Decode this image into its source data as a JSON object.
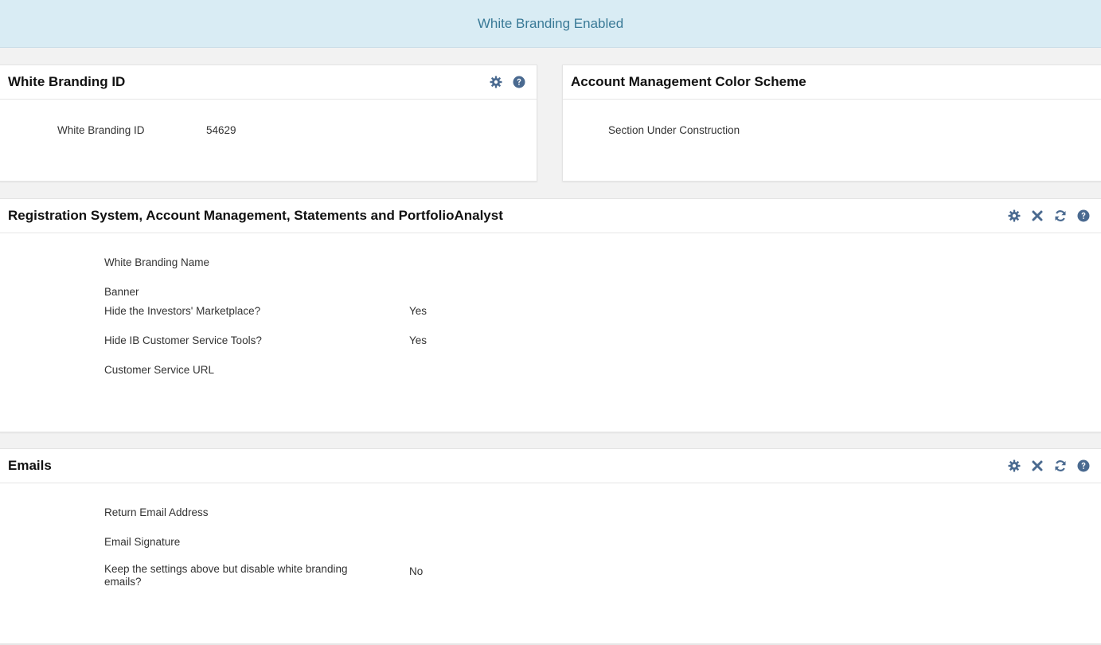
{
  "banner": {
    "text": "White Branding Enabled"
  },
  "colors": {
    "banner_bg": "#d9ecf4",
    "banner_text": "#3a7a97",
    "icon": "#4a6a90"
  },
  "panel_id": {
    "title": "White Branding ID",
    "icons": [
      "gear-icon",
      "help-icon"
    ],
    "fields": [
      {
        "label": "White Branding ID",
        "value": "54629"
      }
    ]
  },
  "panel_color": {
    "title": "Account Management Color Scheme",
    "message": "Section Under Construction"
  },
  "panel_registration": {
    "title": "Registration System, Account Management, Statements and PortfolioAnalyst",
    "icons": [
      "gear-icon",
      "close-icon",
      "refresh-icon",
      "help-icon"
    ],
    "fields": [
      {
        "label": "White Branding Name",
        "value": ""
      },
      {
        "label": "Banner",
        "value": ""
      },
      {
        "label": "Hide the Investors' Marketplace?",
        "value": "Yes"
      },
      {
        "label": "Hide IB Customer Service Tools?",
        "value": "Yes"
      },
      {
        "label": "Customer Service URL",
        "value": ""
      }
    ]
  },
  "panel_emails": {
    "title": "Emails",
    "icons": [
      "gear-icon",
      "close-icon",
      "refresh-icon",
      "help-icon"
    ],
    "fields": [
      {
        "label": "Return Email Address",
        "value": ""
      },
      {
        "label": "Email Signature",
        "value": ""
      },
      {
        "label": "Keep the settings above but disable white branding emails?",
        "value": "No"
      }
    ]
  }
}
